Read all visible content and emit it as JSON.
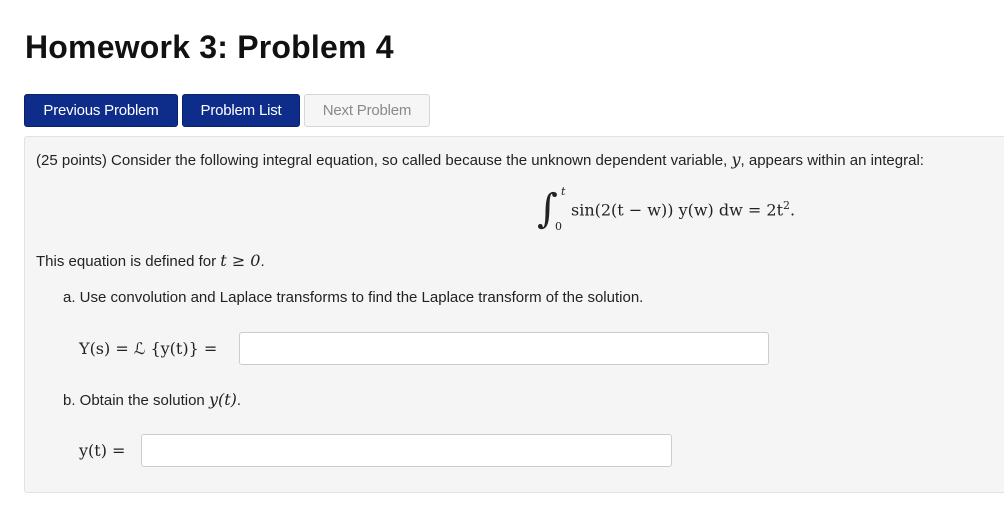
{
  "header": {
    "title": "Homework 3: Problem 4"
  },
  "nav": {
    "previous_label": "Previous Problem",
    "list_label": "Problem List",
    "next_label": "Next Problem"
  },
  "problem": {
    "intro_prefix": "(25 points) Consider the following integral equation, so called because the unknown dependent variable,",
    "intro_var": "y",
    "intro_suffix": ", appears within an integral:",
    "equation": {
      "upper_limit": "t",
      "lower_limit": "0",
      "integrand": "sin(2(t − w)) y(w) dw = 2t",
      "exponent": "2",
      "tail": "."
    },
    "domain_text": "This equation is defined for",
    "domain_condition": "t ≥ 0",
    "domain_end": ".",
    "part_a": {
      "text": "a. Use convolution and Laplace transforms to find the Laplace transform of the solution.",
      "answer_label": "Y(s) = ℒ {y(t)} =",
      "answer_value": ""
    },
    "part_b": {
      "text": "b. Obtain the solution",
      "text_var": "y(t)",
      "text_end": ".",
      "answer_label": "y(t) =",
      "answer_value": ""
    }
  },
  "colors": {
    "primary_button": "#0e2d8b",
    "disabled_button": "#f6f6f6",
    "problem_background": "#f5f5f5"
  }
}
